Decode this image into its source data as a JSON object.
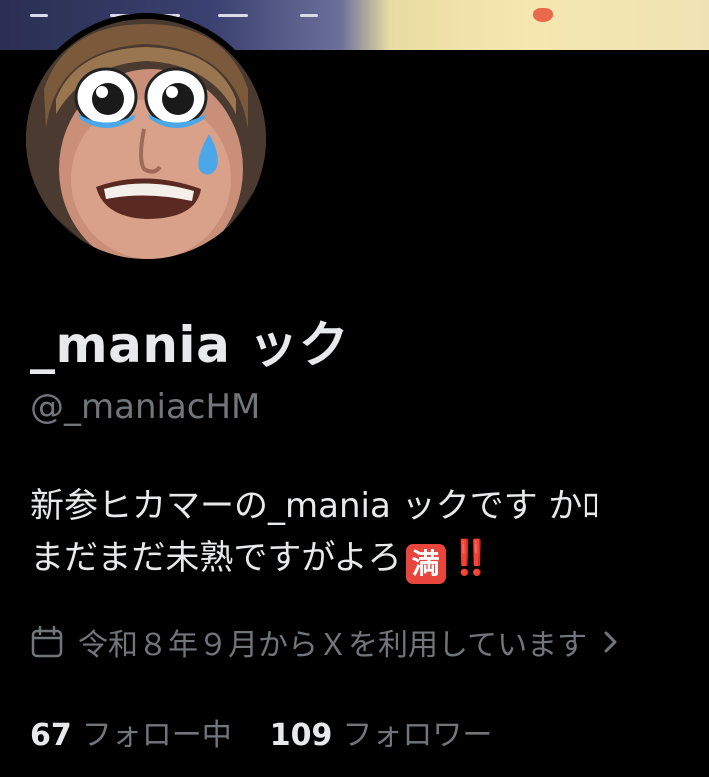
{
  "profile": {
    "display_name": "_mania ック",
    "handle": "@_maniacHM",
    "bio_lines": [
      "新参ヒカマーの_mania ックです かﾛ",
      "まだまだ未熟ですがよろ"
    ],
    "bio_emoji_text": "満",
    "bio_emoji_bang": "‼️",
    "joined": "令和８年９月からＸを利用しています",
    "following_count": "67",
    "following_label": "フォロー中",
    "followers_count": "109",
    "followers_label": "フォロワー"
  },
  "icons": {
    "calendar": "calendar-icon",
    "chevron": "chevron-right-icon"
  },
  "colors": {
    "background": "#000000",
    "primary_text": "#e7e9ea",
    "secondary_text": "#71767b",
    "emoji_red": "#e8453c"
  }
}
